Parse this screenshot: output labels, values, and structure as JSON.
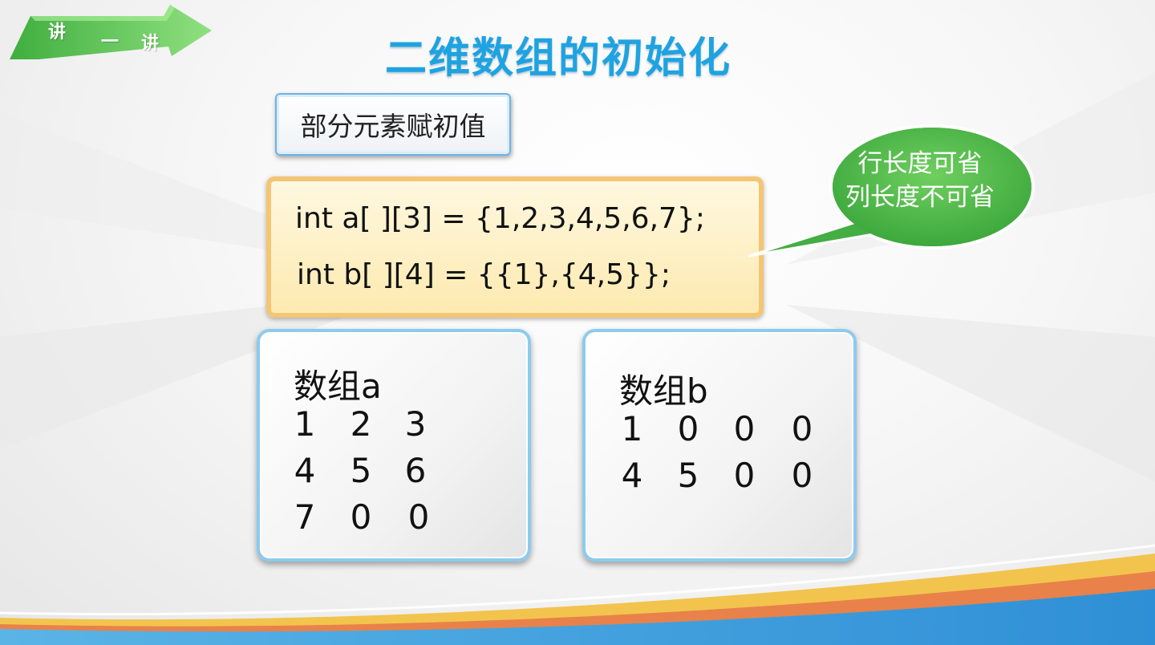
{
  "badge": {
    "char1": "讲",
    "char2": "一",
    "char3": "讲"
  },
  "title": "二维数组的初始化",
  "subtitle": "部分元素赋初值",
  "code": {
    "line1": "int a[ ][3] = {1,2,3,4,5,6,7};",
    "line2": "int b[ ][4] = {{1},{4,5}};"
  },
  "bubble": {
    "line1": "行长度可省",
    "line2": "列长度不可省"
  },
  "array_a": {
    "title": "数组a",
    "rows": [
      [
        "1",
        "2",
        "3"
      ],
      [
        "4",
        "5",
        "6"
      ],
      [
        "7",
        "0",
        "0"
      ]
    ]
  },
  "array_b": {
    "title": "数组b",
    "rows": [
      [
        "1",
        "0",
        "0",
        "0"
      ],
      [
        "4",
        "5",
        "0",
        "0"
      ]
    ]
  },
  "colors": {
    "title": "#1fa3e0",
    "bubble": "#4cb84c",
    "badge": "#5cc25c",
    "code_border": "#f3c675",
    "box_border": "#8ccbee"
  }
}
